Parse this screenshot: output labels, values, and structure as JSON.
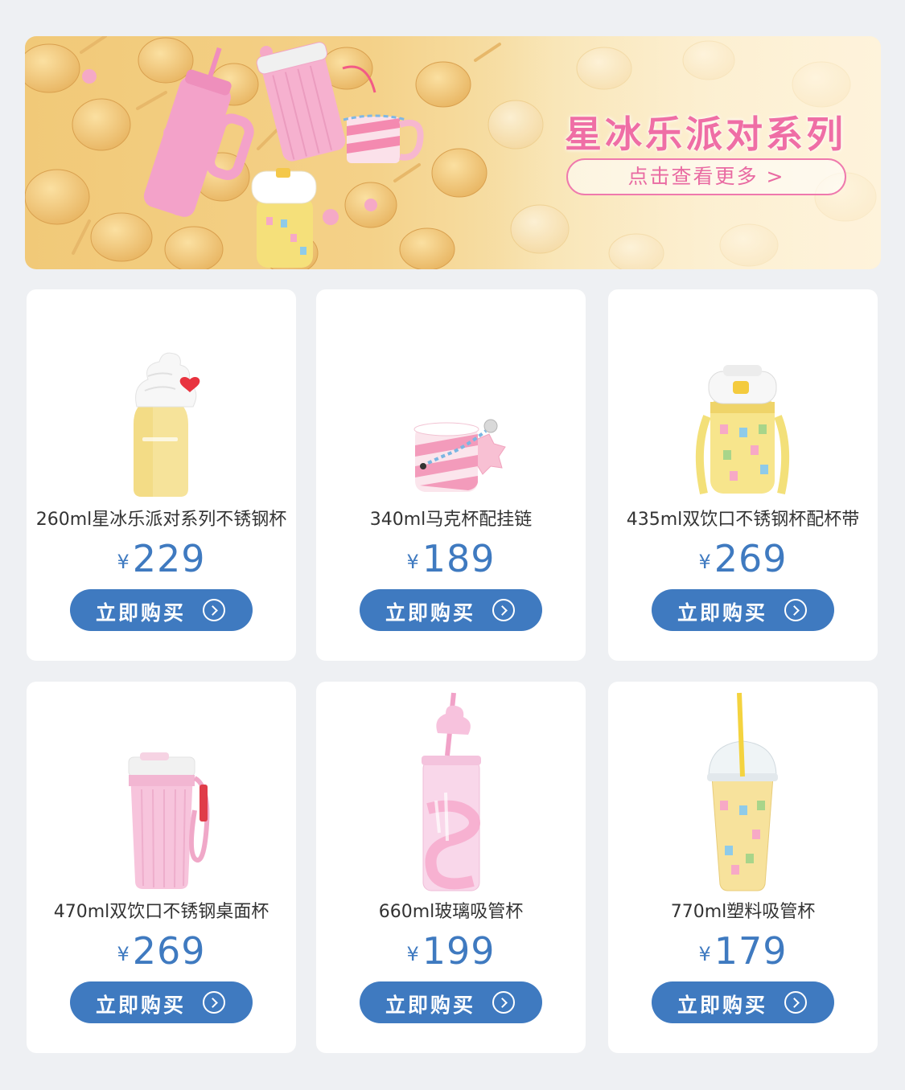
{
  "banner": {
    "title": "星冰乐派对系列",
    "cta_label": "点击查看更多 >",
    "colors": {
      "title": "#ef6ea5",
      "cta_border": "#ef79ad",
      "background": "#f4d188"
    }
  },
  "currency_symbol": "¥",
  "buy_label": "立即购买",
  "accent_color": "#3f7ac0",
  "products": [
    {
      "name": "260ml星冰乐派对系列不锈钢杯",
      "price": "229",
      "image": "yellow-bottle-with-whipped-cream-lid"
    },
    {
      "name": "340ml马克杯配挂链",
      "price": "189",
      "image": "pink-striped-mug-with-charm-chain"
    },
    {
      "name": "435ml双饮口不锈钢杯配杯带",
      "price": "269",
      "image": "yellow-tumbler-with-strap"
    },
    {
      "name": "470ml双饮口不锈钢桌面杯",
      "price": "269",
      "image": "pink-ribbed-tumbler-with-strap"
    },
    {
      "name": "660ml玻璃吸管杯",
      "price": "199",
      "image": "pink-glass-straw-cup"
    },
    {
      "name": "770ml塑料吸管杯",
      "price": "179",
      "image": "yellow-plastic-straw-cup"
    }
  ]
}
